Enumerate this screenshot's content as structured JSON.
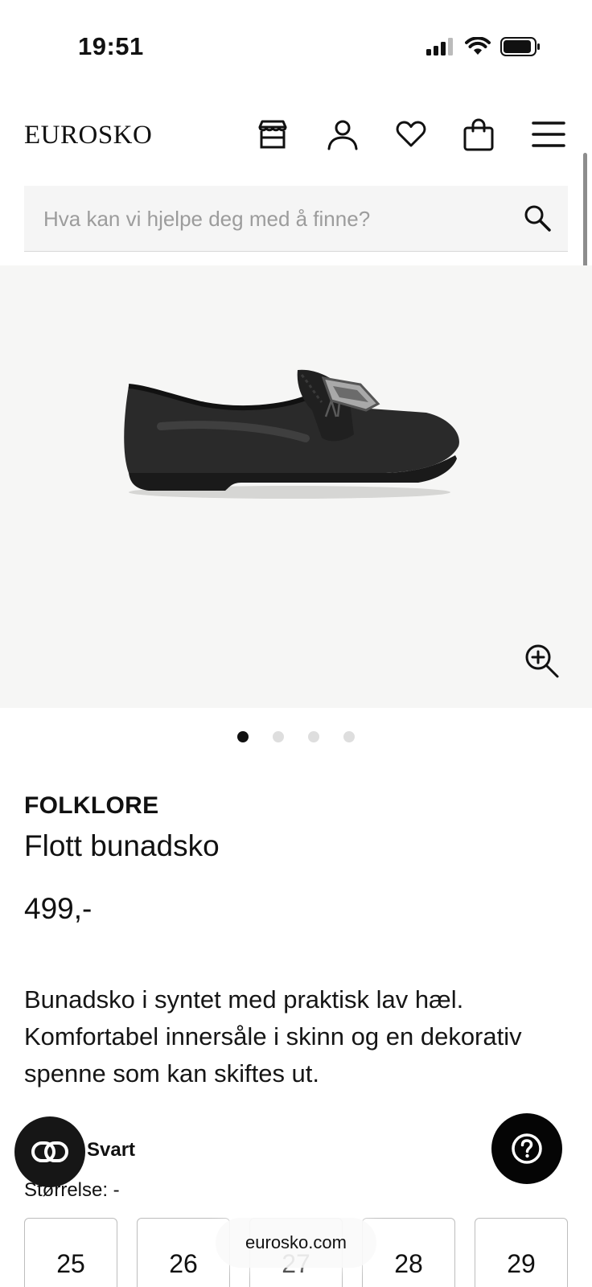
{
  "status_bar": {
    "time": "19:51"
  },
  "header": {
    "logo": "EUROSKO",
    "icons": [
      "store-icon",
      "user-icon",
      "heart-icon",
      "bag-icon",
      "menu-icon"
    ]
  },
  "search": {
    "placeholder": "Hva kan vi hjelpe deg med å finne?"
  },
  "gallery": {
    "image_count": 4,
    "active_index": 0
  },
  "product": {
    "brand": "FOLKLORE",
    "title": "Flott bunadsko",
    "price": "499,-",
    "description": "Bunadsko i syntet med praktisk lav hæl. Komfortabel innersåle i skinn og en dekorativ spenne som kan skiftes ut.",
    "color_value": "Svart",
    "size_label": "Størrelse: -",
    "sizes": [
      "25",
      "26",
      "27",
      "28",
      "29"
    ]
  },
  "browser": {
    "url": "eurosko.com"
  },
  "colors": {
    "accent": "#111111",
    "gallery_bg": "#f6f6f5"
  }
}
